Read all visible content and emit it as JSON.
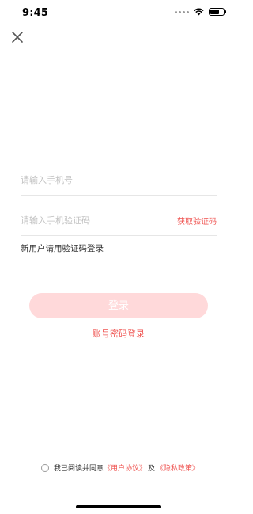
{
  "status_bar": {
    "time": "9:45",
    "battery_level": 0.7,
    "icons": [
      "signal-icon",
      "wifi-icon",
      "battery-icon"
    ]
  },
  "close_icon": "close-icon",
  "phone": {
    "placeholder": "请输入手机号",
    "value": ""
  },
  "code": {
    "placeholder": "请输入手机验证码",
    "value": "",
    "get_code_label": "获取验证码"
  },
  "hint": "新用户请用验证码登录",
  "login_label": "登录",
  "password_login_label": "账号密码登录",
  "agreement": {
    "prefix": "我已阅读并同意",
    "user_agreement": "《用户协议》",
    "conjunction": "及",
    "privacy_policy": "《隐私政策》",
    "checked": false
  },
  "colors": {
    "accent": "#ef5350",
    "button_disabled_bg": "#ffd9da",
    "placeholder": "#c2c2c2"
  }
}
